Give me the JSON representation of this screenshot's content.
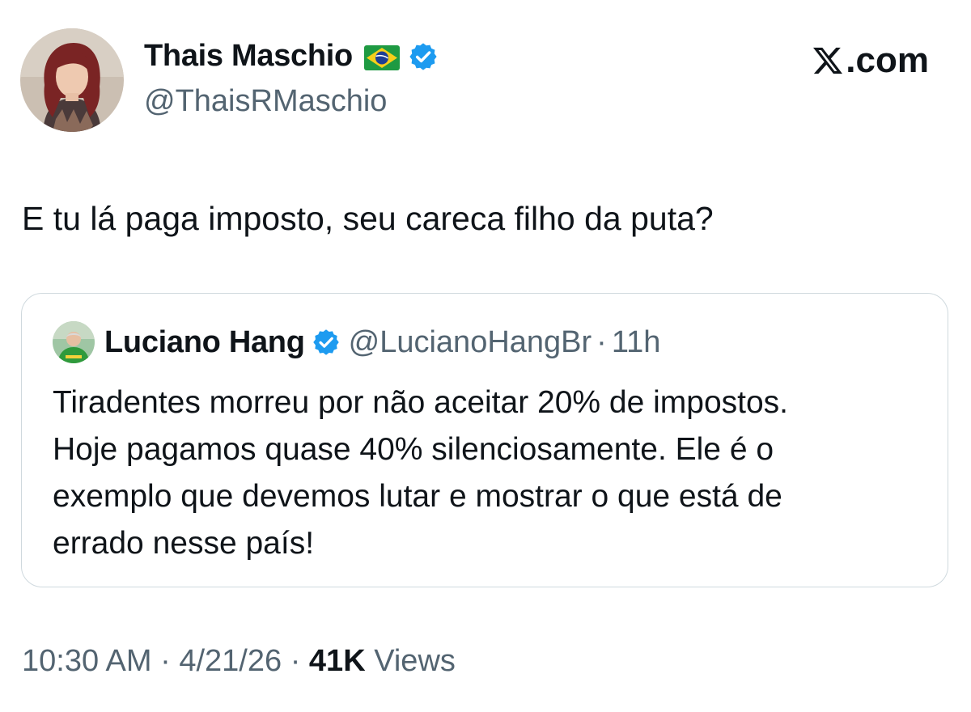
{
  "author": {
    "display_name": "Thais Maschio",
    "flag_icon": "brazil-flag-icon",
    "verified_icon": "verified-badge-icon",
    "handle": "@ThaisRMaschio"
  },
  "brand": {
    "logo_icon": "x-logo-icon",
    "suffix": ".com"
  },
  "tweet": {
    "text": "E tu lá paga imposto, seu careca filho da puta?"
  },
  "quoted_tweet": {
    "display_name": "Luciano Hang",
    "verified_icon": "verified-badge-icon",
    "handle": "@LucianoHangBr",
    "separator": "·",
    "time": "11h",
    "lines": [
      "Tiradentes morreu por não aceitar 20% de impostos.",
      "Hoje pagamos quase 40% silenciosamente. Ele é o",
      "exemplo que devemos lutar e mostrar o que está de",
      "errado nesse país!"
    ]
  },
  "footer": {
    "time": "10:30 AM",
    "separator": "·",
    "date": "4/21/26",
    "views_count": "41K",
    "views_label": "Views"
  },
  "colors": {
    "text": "#0f1419",
    "secondary": "#536471",
    "verified": "#1d9bf0",
    "border": "#cfd9de"
  }
}
